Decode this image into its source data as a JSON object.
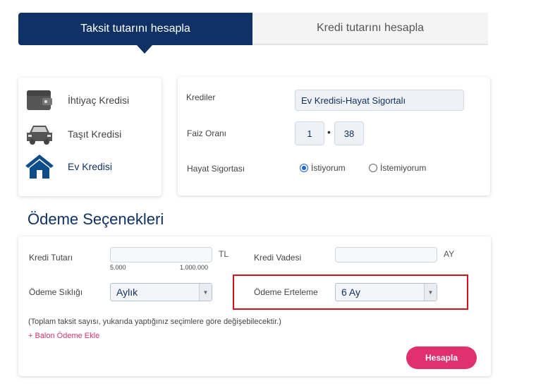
{
  "tabs": {
    "active_label": "Taksit tutarını hesapla",
    "inactive_label": "Kredi tutarını hesapla"
  },
  "loan_types": {
    "items": [
      {
        "label": "İhtiyaç Kredisi",
        "icon": "wallet-icon"
      },
      {
        "label": "Taşıt Kredisi",
        "icon": "car-icon"
      },
      {
        "label": "Ev Kredisi",
        "icon": "house-icon",
        "selected": true
      }
    ]
  },
  "settings": {
    "credits_label": "Krediler",
    "credits_value": "Ev Kredisi-Hayat Sigortalı",
    "interest_label": "Faiz Oranı",
    "interest_int": "1",
    "interest_dec": "38",
    "insurance_label": "Hayat Sigortası",
    "insurance_yes": "İstiyorum",
    "insurance_no": "İstemiyorum",
    "insurance_selected": "İstiyorum"
  },
  "payment_options": {
    "title": "Ödeme Seçenekleri",
    "amount_label": "Kredi Tutarı",
    "amount_value": "",
    "amount_unit": "TL",
    "amount_min": "5.000",
    "amount_max": "1.000.000",
    "term_label": "Kredi Vadesi",
    "term_value": "",
    "term_unit": "AY",
    "frequency_label": "Ödeme Sıklığı",
    "frequency_value": "Aylık",
    "deferral_label": "Ödeme Erteleme",
    "deferral_value": "6 Ay",
    "note": "(Toplam taksit sayısı, yukarıda yaptığınız seçimlere göre değişebilecektir.)",
    "balloon_link": "+ Balon Ödeme Ekle",
    "calculate_button": "Hesapla"
  },
  "colors": {
    "brand_navy": "#0f3165",
    "accent_pink": "#e0306e",
    "highlight_red": "#d6111b"
  }
}
